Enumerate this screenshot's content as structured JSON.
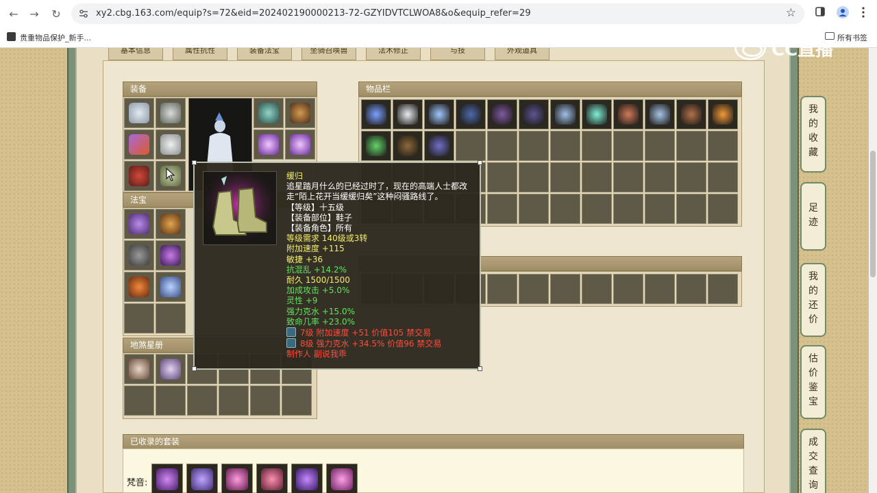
{
  "browser": {
    "url": "xy2.cbg.163.com/equip?s=72&eid=202402190000213-72-GZYIDVTCLWOA8&o&equip_refer=29",
    "bookmark": "贵重物品保护_新手...",
    "all_bookmarks": "所有书签"
  },
  "watermark": "CC直播",
  "tabs": [
    "基本信息",
    "属性抗性",
    "装备法宝",
    "坐骑召唤兽",
    "法术修正",
    "与技",
    "外观道具"
  ],
  "panels": {
    "equipment": "装备",
    "items": "物品栏",
    "fabao": "法宝",
    "dijun": "地煞星册",
    "collected_sets": "已收录的套装",
    "set_label": "梵音:"
  },
  "tooltip": {
    "name": "缓归",
    "desc_line1": "追星踏月什么的已经过时了，现在的高端人士都改",
    "desc_line2": "走“陌上花开当缓缓归矣”这种闷骚路线了。",
    "level": "【等级】十五级",
    "slot": "【装备部位】鞋子",
    "role": "【装备角色】所有",
    "requirement": "等级需求 140级或3转",
    "stats": [
      "附加速度 +115",
      "敏捷 +36",
      "抗混乱 +14.2%",
      "耐久 1500/1500",
      "加成攻击 +5.0%",
      "灵性 +9",
      "强力克水 +15.0%",
      "致命几率 +23.0%"
    ],
    "gem1": "7级 附加速度 +51 价值105 禁交易",
    "gem2": "8级 强力克水 +34.5% 价值96 禁交易",
    "maker": "制作人 副说我乖"
  },
  "side_nav": [
    [
      "我",
      "的",
      "收",
      "藏"
    ],
    [
      "足",
      "迹"
    ],
    [
      "我",
      "的",
      "还",
      "价"
    ],
    [
      "估",
      "价",
      "鉴",
      "宝"
    ],
    [
      "成",
      "交",
      "查",
      "询"
    ]
  ],
  "colors": {
    "tooltip_bg": "#2d291e",
    "tooltip_name": "#f3ee6a",
    "tooltip_green": "#63e35e",
    "tooltip_red": "#ff4b3c",
    "frame_green": "#7b9278"
  }
}
